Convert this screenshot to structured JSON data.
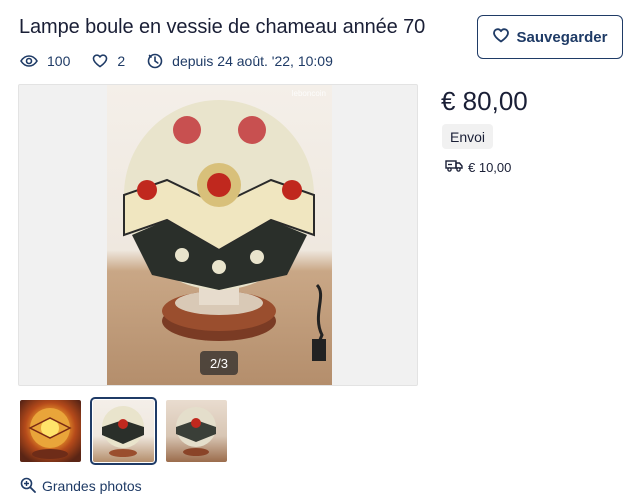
{
  "listing": {
    "title": "Lampe boule en vessie de chameau année 70",
    "save_label": "Sauvegarder",
    "views": "100",
    "favorites": "2",
    "posted": "depuis 24 août. '22, 10:09",
    "price": "€ 80,00",
    "delivery_tag": "Envoi",
    "shipping_cost": "€ 10,00"
  },
  "gallery": {
    "watermark": "leboncoin",
    "counter": "2/3",
    "big_photos_label": "Grandes photos",
    "active_index": 2,
    "total": 3
  },
  "colors": {
    "primary": "#1f3b66",
    "text": "#1a1f36",
    "tag_bg": "#f1f1f1"
  },
  "icons": {
    "save": "heart-icon",
    "views": "eye-icon",
    "favorites": "heart-icon",
    "posted": "clock-icon",
    "shipping": "truck-icon",
    "big_photos": "zoom-in-icon"
  }
}
